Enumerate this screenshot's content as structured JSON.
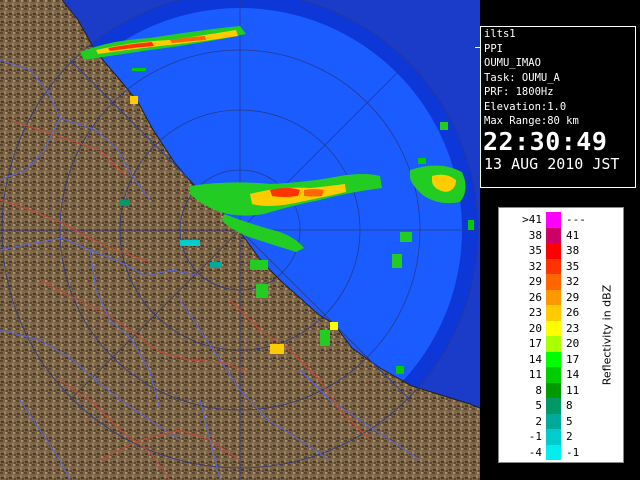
{
  "info_panel": {
    "station": "ilts1",
    "scan_type": "PPI",
    "product": "OUMU_IMAO",
    "task": "Task: OUMU_A",
    "prf": "PRF: 1800Hz",
    "elevation": "Elevation:1.0",
    "max_range": "Max Range:80 km",
    "time": "22:30:49",
    "date": "13 AUG 2010 JST"
  },
  "legend": {
    "unit_label": "Reflectivity in dBZ",
    "rows": [
      {
        "lo": ">41",
        "hi": "---",
        "color": "#ff00ff"
      },
      {
        "lo": "38",
        "hi": "41",
        "color": "#cc0066"
      },
      {
        "lo": "35",
        "hi": "38",
        "color": "#ff0000"
      },
      {
        "lo": "32",
        "hi": "35",
        "color": "#ff3300"
      },
      {
        "lo": "29",
        "hi": "32",
        "color": "#ff6600"
      },
      {
        "lo": "26",
        "hi": "29",
        "color": "#ff9900"
      },
      {
        "lo": "23",
        "hi": "26",
        "color": "#ffcc00"
      },
      {
        "lo": "20",
        "hi": "23",
        "color": "#ffff00"
      },
      {
        "lo": "17",
        "hi": "20",
        "color": "#aaff00"
      },
      {
        "lo": "14",
        "hi": "17",
        "color": "#00ff00"
      },
      {
        "lo": "11",
        "hi": "14",
        "color": "#00cc00"
      },
      {
        "lo": "8",
        "hi": "11",
        "color": "#009900"
      },
      {
        "lo": "5",
        "hi": "8",
        "color": "#009966"
      },
      {
        "lo": "2",
        "hi": "5",
        "color": "#00aa99"
      },
      {
        "lo": "-1",
        "hi": "2",
        "color": "#00cccc"
      },
      {
        "lo": "-4",
        "hi": "-1",
        "color": "#00eeee"
      }
    ]
  },
  "map": {
    "sea_color": "#1155ff",
    "outer_ring_color": "#0a2fd0",
    "land_color": "#7a6244",
    "boundary_color": "#4f5fd8",
    "river_color": "#c84a3a",
    "range_rings_km": [
      20,
      40,
      60,
      80
    ]
  }
}
